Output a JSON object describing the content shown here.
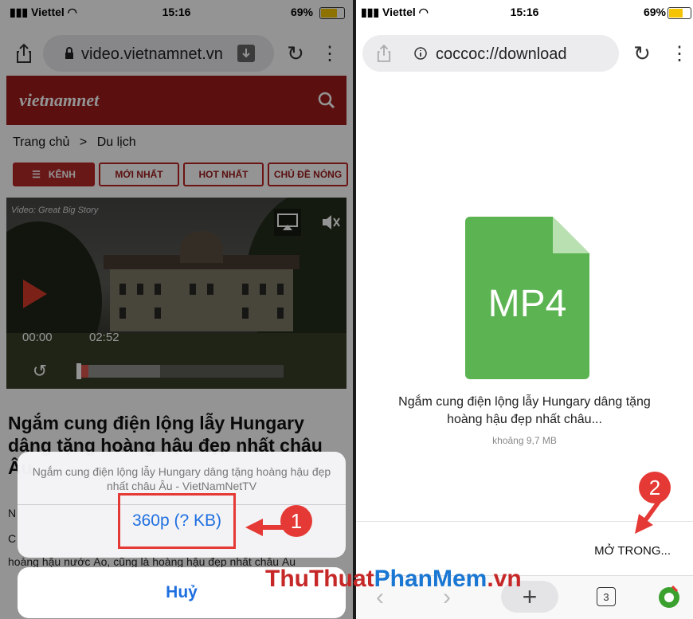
{
  "left": {
    "status": {
      "carrier": "Viettel",
      "time": "15:16",
      "battery": "69%"
    },
    "url": "video.vietnamnet.vn",
    "logo": "vietnamnet",
    "breadcrumb": {
      "home": "Trang chủ",
      "sep": ">",
      "current": "Du lịch"
    },
    "nav": {
      "kenh": "KÊNH",
      "moi_nhat": "MỚI NHẤT",
      "hot_nhat": "HOT NHẤT",
      "chu_de": "CHỦ ĐỀ NÓNG"
    },
    "video": {
      "source": "Video: Great Big Story",
      "current_time": "00:00",
      "duration": "02:52",
      "progress": 0.05,
      "buffered": 0.4
    },
    "article_title": "Ngắm cung điện lộng lẫy Hungary dâng tặng hoàng hậu đẹp nhất châu Âu",
    "body_peek": "hoàng hậu nước Áo, cũng là hoàng hậu đẹp nhất châu Âu",
    "body_letters": [
      "N",
      "C"
    ],
    "sheet": {
      "message": "Ngắm cung điện lộng lẫy Hungary dâng tặng hoàng hậu đẹp nhất châu Âu - VietNamNetTV",
      "option": "360p  (? KB)",
      "cancel": "Huỷ"
    },
    "step": "1"
  },
  "right": {
    "status": {
      "carrier": "Viettel",
      "time": "15:16",
      "battery": "69%"
    },
    "url": "coccoc://download",
    "file_type": "MP4",
    "file_name": "Ngắm cung điện lộng lẫy Hungary dâng tặng hoàng hậu đẹp nhất châu...",
    "file_size": "khoảng 9,7 MB",
    "open_in": "MỞ TRONG...",
    "tab_count": "3",
    "step": "2"
  },
  "watermark": {
    "part1": "ThuThuat",
    "part2": "PhanMem",
    "part3": ".vn"
  },
  "colors": {
    "accent_red": "#e53935",
    "brand_red": "#9e1b1b",
    "mp4_green": "#5bb352",
    "link_blue": "#1e6fe0"
  }
}
